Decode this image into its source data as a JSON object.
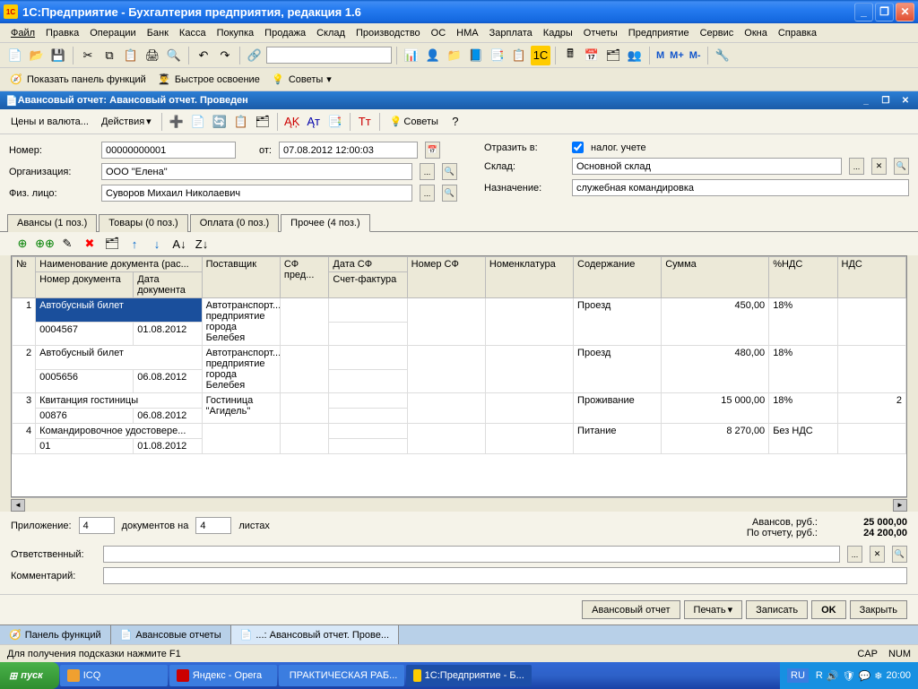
{
  "titlebar": {
    "title": "1С:Предприятие - Бухгалтерия предприятия, редакция 1.6"
  },
  "menu": [
    "Файл",
    "Правка",
    "Операции",
    "Банк",
    "Касса",
    "Покупка",
    "Продажа",
    "Склад",
    "Производство",
    "ОС",
    "НМА",
    "Зарплата",
    "Кадры",
    "Отчеты",
    "Предприятие",
    "Сервис",
    "Окна",
    "Справка"
  ],
  "toolbar2": {
    "panel_btn": "Показать панель функций",
    "quick": "Быстрое освоение",
    "tips": "Советы"
  },
  "doc": {
    "title": "Авансовый отчет: Авансовый отчет. Проведен",
    "prices_btn": "Цены и валюта...",
    "actions_btn": "Действия",
    "tips_btn": "Советы"
  },
  "form": {
    "number_lbl": "Номер:",
    "number": "00000000001",
    "from_lbl": "от:",
    "date": "07.08.2012 12:00:03",
    "org_lbl": "Организация:",
    "org": "ООО \"Елена\"",
    "person_lbl": "Физ. лицо:",
    "person": "Суворов Михаил Николаевич",
    "reflect_lbl": "Отразить в:",
    "reflect_chk": "налог. учете",
    "warehouse_lbl": "Склад:",
    "warehouse": "Основной склад",
    "purpose_lbl": "Назначение:",
    "purpose": "служебная командировка"
  },
  "tabs": [
    "Авансы (1 поз.)",
    "Товары (0 поз.)",
    "Оплата (0 поз.)",
    "Прочее (4 поз.)"
  ],
  "grid": {
    "headers": {
      "n": "№",
      "doc_name": "Наименование документа (рас...",
      "doc_num": "Номер документа",
      "doc_date": "Дата документа",
      "supplier": "Поставщик",
      "sf_pred": "СФ пред...",
      "date_sf": "Дата СФ",
      "sf_account": "Счет-фактура",
      "num_sf": "Номер СФ",
      "nomen": "Номенклатура",
      "content": "Содержание",
      "sum": "Сумма",
      "vat_pct": "%НДС",
      "vat": "НДС"
    },
    "rows": [
      {
        "n": "1",
        "doc_name": "Автобусный    билет",
        "doc_num": "0004567",
        "doc_date": "01.08.2012",
        "supplier": "Автотранспорт... предприятие города Белебея",
        "content": "Проезд",
        "sum": "450,00",
        "vat_pct": "18%",
        "vat": ""
      },
      {
        "n": "2",
        "doc_name": "Автобусный билет",
        "doc_num": "0005656",
        "doc_date": "06.08.2012",
        "supplier": "Автотранспорт... предприятие города Белебея",
        "content": "Проезд",
        "sum": "480,00",
        "vat_pct": "18%",
        "vat": ""
      },
      {
        "n": "3",
        "doc_name": "Квитанция гостиницы",
        "doc_num": "00876",
        "doc_date": "06.08.2012",
        "supplier": "Гостиница \"Агидель\"",
        "content": "Проживание",
        "sum": "15 000,00",
        "vat_pct": "18%",
        "vat": "2"
      },
      {
        "n": "4",
        "doc_name": "Командировочное удостовере...",
        "doc_num": "01",
        "doc_date": "01.08.2012",
        "supplier": "",
        "content": "Питание",
        "sum": "8 270,00",
        "vat_pct": "Без НДС",
        "vat": ""
      }
    ]
  },
  "bottom": {
    "attach_lbl": "Приложение:",
    "attach_count": "4",
    "docs_on": "документов на",
    "sheets": "4",
    "sheets_lbl": "листах",
    "adv_lbl": "Авансов, руб.:",
    "adv_val": "25 000,00",
    "rep_lbl": "По отчету, руб.:",
    "rep_val": "24 200,00",
    "resp_lbl": "Ответственный:",
    "comment_lbl": "Комментарий:"
  },
  "actions": {
    "report": "Авансовый отчет",
    "print": "Печать",
    "save": "Записать",
    "ok": "OK",
    "close": "Закрыть"
  },
  "panels": [
    "Панель функций",
    "Авансовые отчеты",
    "...: Авансовый отчет. Прове..."
  ],
  "statusbar": {
    "hint": "Для получения подсказки нажмите F1",
    "cap": "CAP",
    "num": "NUM"
  },
  "wintaskbar": {
    "start": "пуск",
    "tasks": [
      "ICQ",
      "Яндекс - Opera",
      "ПРАКТИЧЕСКАЯ РАБ...",
      "1С:Предприятие - Б..."
    ],
    "lang": "RU",
    "time": "20:00"
  }
}
